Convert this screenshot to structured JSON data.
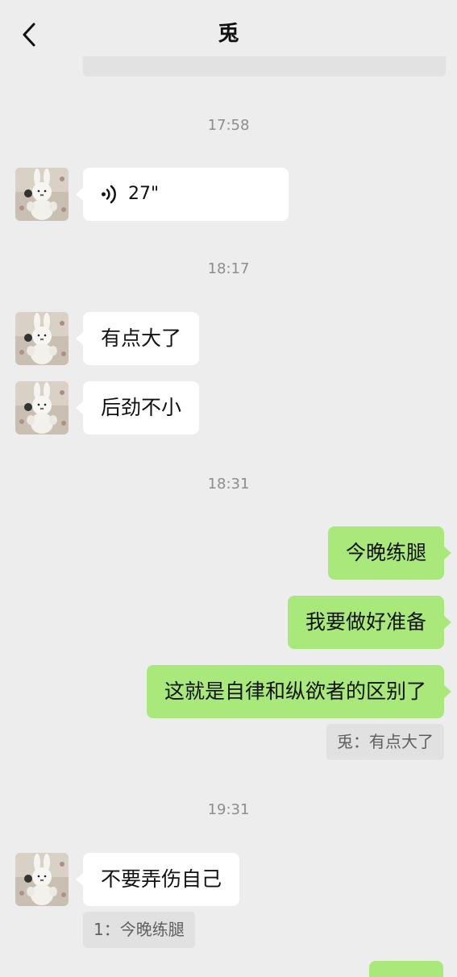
{
  "header": {
    "title": "兎"
  },
  "times": [
    "17:58",
    "18:17",
    "18:31",
    "19:31"
  ],
  "messages": {
    "voice_duration": "27\"",
    "m1": "有点大了",
    "m2": "后劲不小",
    "m3": "今晚练腿",
    "m4": "我要做好准备",
    "m5": "这就是自律和纵欲者的区别了",
    "m6": "不要弄伤自己"
  },
  "quotes": {
    "q1": "兎：有点大了",
    "q2": "1：今晚练腿"
  },
  "colors": {
    "background": "#ededed",
    "sent_bubble": "#a9e97b",
    "received_bubble": "#ffffff",
    "timestamp": "#8d8d8d"
  },
  "icons": [
    "chevron-left-icon",
    "voice-wave-icon"
  ]
}
